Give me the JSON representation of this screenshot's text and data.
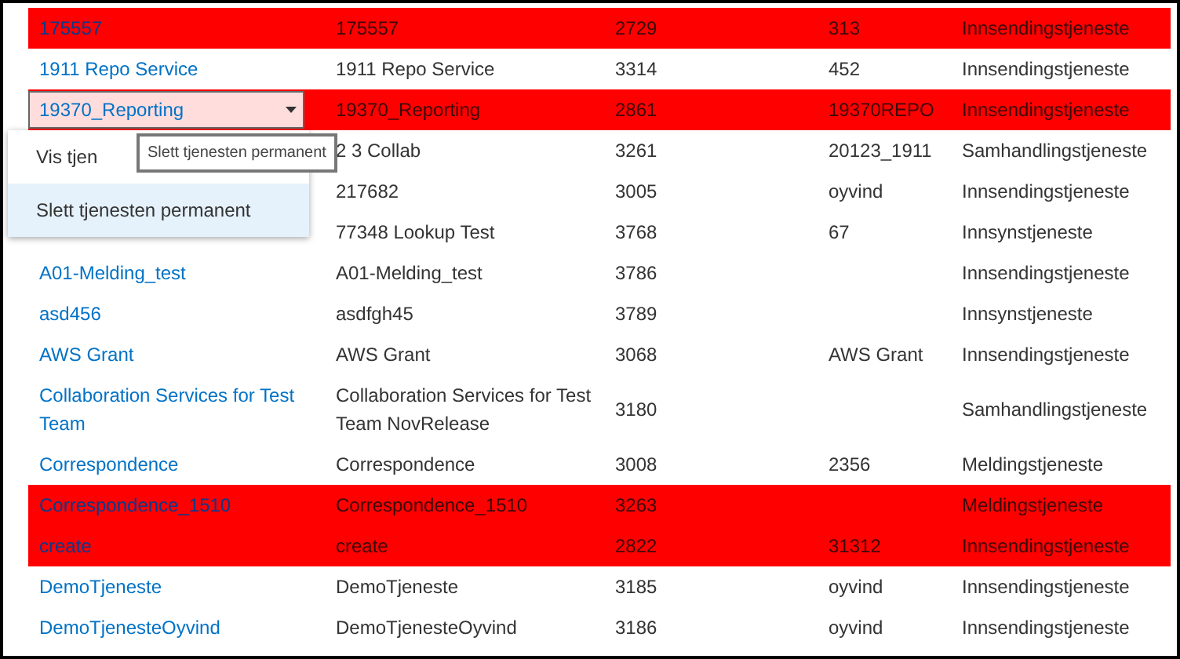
{
  "rows": [
    {
      "highlighted": true,
      "cells": [
        "175557",
        "175557",
        "2729",
        "313",
        "Innsendingstjeneste"
      ]
    },
    {
      "highlighted": false,
      "cells": [
        "1911 Repo Service",
        "1911 Repo Service",
        "3314",
        "452",
        "Innsendingstjeneste"
      ]
    },
    {
      "highlighted": true,
      "menu_open": true,
      "cells": [
        "19370_Reporting",
        "19370_Reporting",
        "2861",
        "19370REPO",
        "Innsendingstjeneste"
      ]
    },
    {
      "highlighted": false,
      "cells": [
        null,
        "2 3 Collab",
        "3261",
        "20123_1911",
        "Samhandlingstjeneste"
      ]
    },
    {
      "highlighted": false,
      "cells": [
        null,
        "217682",
        "3005",
        "oyvind",
        "Innsendingstjeneste"
      ]
    },
    {
      "highlighted": false,
      "cells": [
        null,
        "77348 Lookup Test",
        "3768",
        "67",
        "Innsynstjeneste"
      ]
    },
    {
      "highlighted": false,
      "cells": [
        "A01-Melding_test",
        "A01-Melding_test",
        "3786",
        null,
        "Innsendingstjeneste"
      ]
    },
    {
      "highlighted": false,
      "cells": [
        "asd456",
        "asdfgh45",
        "3789",
        null,
        "Innsynstjeneste"
      ]
    },
    {
      "highlighted": false,
      "cells": [
        "AWS Grant",
        "AWS Grant",
        "3068",
        "AWS Grant",
        "Innsendingstjeneste"
      ]
    },
    {
      "highlighted": false,
      "cells": [
        "Collaboration Services for Test Team",
        "Collaboration Services for Test Team NovRelease",
        "3180",
        null,
        "Samhandlingstjeneste"
      ]
    },
    {
      "highlighted": false,
      "cells": [
        "Correspondence",
        "Correspondence",
        "3008",
        "2356",
        "Meldingstjeneste"
      ]
    },
    {
      "highlighted": true,
      "cells": [
        "Correspondence_1510",
        "Correspondence_1510",
        "3263",
        null,
        "Meldingstjeneste"
      ]
    },
    {
      "highlighted": true,
      "cells": [
        "create",
        "create",
        "2822",
        "31312",
        "Innsendingstjeneste"
      ]
    },
    {
      "highlighted": false,
      "cells": [
        "DemoTjeneste",
        "DemoTjeneste",
        "3185",
        "oyvind",
        "Innsendingstjeneste"
      ]
    },
    {
      "highlighted": false,
      "cells": [
        "DemoTjenesteOyvind",
        "DemoTjenesteOyvind",
        "3186",
        "oyvind",
        "Innsendingstjeneste"
      ]
    }
  ],
  "context_menu": {
    "items": [
      {
        "label": "Vis tjen",
        "hovered": false
      },
      {
        "label": "Slett tjenesten permanent",
        "hovered": true
      }
    ],
    "tooltip": "Slett tjenesten permanent"
  }
}
